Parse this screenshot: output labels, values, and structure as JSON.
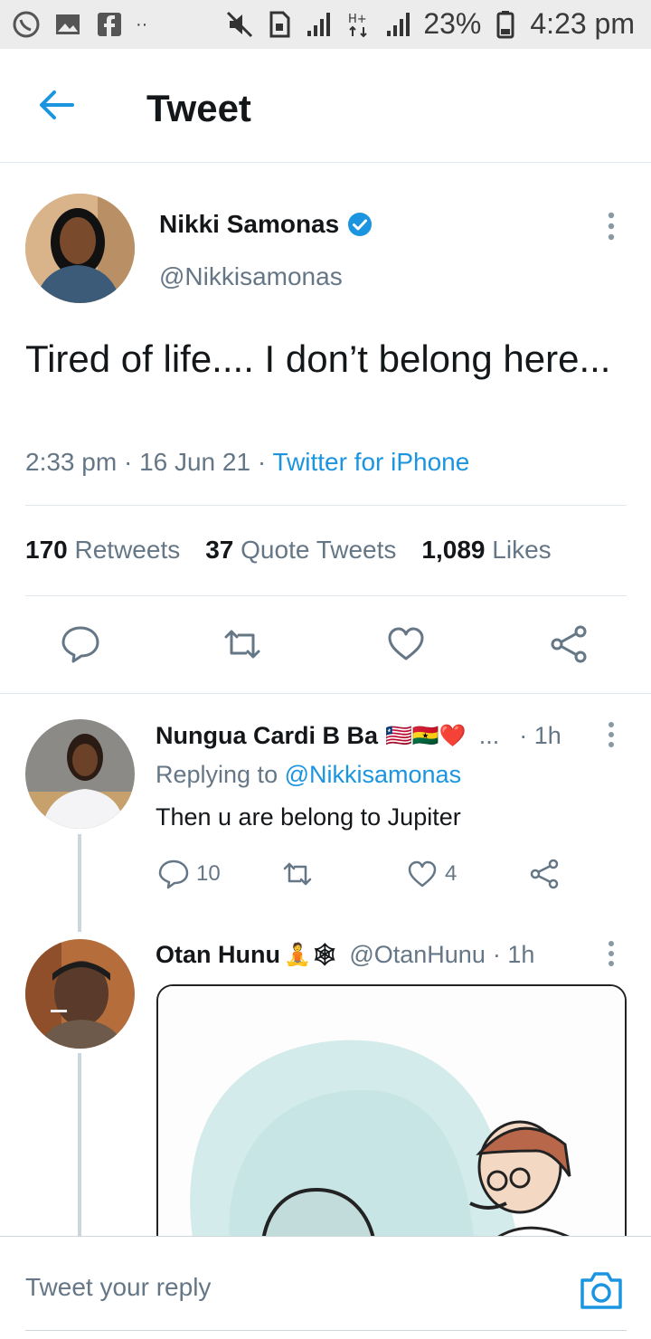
{
  "status_bar": {
    "battery": "23%",
    "time": "4:23 pm",
    "icons": [
      "whatsapp-icon",
      "gallery-icon",
      "facebook-icon",
      "mute-icon",
      "sim-icon",
      "signal-icon",
      "hplus-icon",
      "signal-icon-2",
      "battery-icon"
    ]
  },
  "header": {
    "title": "Tweet",
    "back_icon": "arrow-left-icon"
  },
  "tweet": {
    "author_name": "Nikki Samonas",
    "author_handle": "@Nikkisamonas",
    "text": "Tired of life.... I don’t belong here...",
    "time": "2:33 pm",
    "separator": "·",
    "date": "16 Jun 21",
    "source": "Twitter for iPhone",
    "stats": {
      "retweets_count": "170",
      "retweets_label": "Retweets",
      "quotes_count": "37",
      "quotes_label": "Quote Tweets",
      "likes_count": "1,089",
      "likes_label": "Likes"
    }
  },
  "replies": [
    {
      "name": "Nungua Cardi B Ba",
      "flags": "🇱🇷🇬🇭❤️",
      "ellipsis": "...",
      "time": "· 1h",
      "replying_prefix": "Replying to",
      "replying_handle": "@Nikkisamonas",
      "text": "Then u are belong to Jupiter",
      "reply_count": "10",
      "like_count": "4"
    },
    {
      "name": "Otan Hunu",
      "emoji": "🧘🕸",
      "handle": "@OtanHunu",
      "time": "· 1h"
    }
  ],
  "composer": {
    "placeholder": "Tweet your reply"
  },
  "colors": {
    "accent": "#1b95e0",
    "secondary_text": "#657786",
    "divider": "#e1e8ed"
  }
}
